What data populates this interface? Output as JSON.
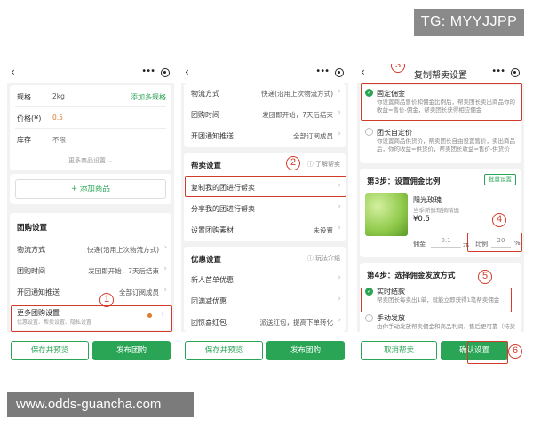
{
  "watermark_top": "TG: MYYJJPP",
  "watermark_bottom": "www.odds-guancha.com",
  "phone1": {
    "fields": [
      {
        "label": "规格",
        "value": "2kg",
        "action": "添加多规格"
      },
      {
        "label": "价格(¥)",
        "value": "0.5"
      },
      {
        "label": "库存",
        "value": "不限"
      }
    ],
    "more_settings": "更多商品设置",
    "add_product": "+ 添加商品",
    "section_title": "团购设置",
    "rows": [
      {
        "label": "物流方式",
        "value": "快递(沿用上次物流方式)"
      },
      {
        "label": "团购时间",
        "value": "发团即开始，7天后结束"
      },
      {
        "label": "开团通知推送",
        "value": "全部订阅成员"
      }
    ],
    "more_group": {
      "label": "更多团购设置",
      "desc": "优惠设置、帮卖设置、隐私设置"
    },
    "save_preview": "保存并预览",
    "publish": "发布团购",
    "badge": "1"
  },
  "phone2": {
    "rows_top": [
      {
        "label": "物流方式",
        "value": "快递(沿用上次物流方式)"
      },
      {
        "label": "团购时间",
        "value": "发团即开始，7天后结束"
      },
      {
        "label": "开团通知推送",
        "value": "全部订阅成员"
      }
    ],
    "help_section": "帮卖设置",
    "help_link": "了解帮卖",
    "help_rows": [
      {
        "label": "复制我的团进行帮卖",
        "value": ""
      },
      {
        "label": "分享我的团进行帮卖",
        "value": ""
      },
      {
        "label": "设置团购素材",
        "value": "未设置"
      }
    ],
    "promo_section": "优惠设置",
    "promo_link": "玩法介绍",
    "promo_rows": [
      {
        "label": "新人首单优惠",
        "value": ""
      },
      {
        "label": "团满减优惠",
        "value": ""
      },
      {
        "label": "团惊喜红包",
        "value": "派送红包，提高下单转化"
      }
    ],
    "save_preview": "保存并预览",
    "publish": "发布团购",
    "badge": "2"
  },
  "phone3": {
    "title": "复制帮卖设置",
    "opt_fixed": {
      "label": "固定佣金",
      "desc": "你设置商品售价和佣金比例后，帮卖团长卖出商品你的收益=售价-佣金，帮卖团长获得相应佣金"
    },
    "opt_custom": {
      "label": "团长自定价",
      "desc": "你设置商品供货价，帮卖团长自由设置售价，卖出商品后，你的收益=供货价，帮卖团长收益=售价-供货价"
    },
    "step3": "第3步：设置佣金比例",
    "batch": "批量设置",
    "product": {
      "name": "阳光玫瑰",
      "sub": "当季新鲜现摘精选",
      "price": "¥0.5"
    },
    "commission_label": "佣金",
    "commission_value": "0.1",
    "commission_unit": "元",
    "ratio_label": "比例",
    "ratio_value": "20",
    "ratio_unit": "%",
    "step4": "第4步：选择佣金发放方式",
    "opt_realtime": {
      "label": "实时结款",
      "desc": "帮卖团长每卖出1单，就能立即获得1笔帮卖佣金"
    },
    "opt_manual": {
      "label": "手动发放",
      "desc": "由你手动发放帮卖佣金和商品利润，售后更可靠（待货后结算"
    },
    "cancel": "取消帮卖",
    "confirm": "确认设置",
    "badges": [
      "3",
      "4",
      "5",
      "6"
    ]
  },
  "colors": {
    "accent": "#2aa556",
    "annotation": "#d23a2a"
  }
}
